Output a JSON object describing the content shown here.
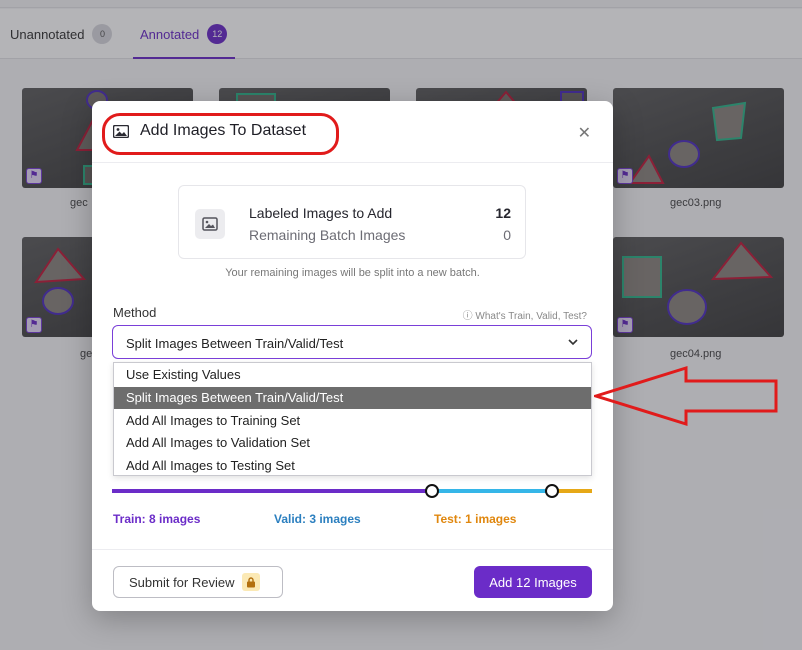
{
  "tabs": [
    {
      "label": "Unannotated",
      "count": "0"
    },
    {
      "label": "Annotated",
      "count": "12"
    }
  ],
  "thumbnails": [
    {
      "name": "gec"
    },
    {
      "name": "gec03.png"
    },
    {
      "name": "gec"
    },
    {
      "name": "gec04.png"
    }
  ],
  "modal": {
    "title": "Add Images To Dataset",
    "close_icon": "close-icon",
    "summary": {
      "labeled_label": "Labeled Images to Add",
      "labeled_value": "12",
      "remaining_label": "Remaining Batch Images",
      "remaining_value": "0",
      "note": "Your remaining images will be split into a new batch."
    },
    "method": {
      "label": "Method",
      "help": "What's Train, Valid, Test?",
      "selected": "Split Images Between Train/Valid/Test",
      "options": [
        "Use Existing Values",
        "Split Images Between Train/Valid/Test",
        "Add All Images to Training Set",
        "Add All Images to Validation Set",
        "Add All Images to Testing Set"
      ],
      "selected_index": 1
    },
    "split": {
      "train_label": "Train: 8 images",
      "valid_label": "Valid: 3 images",
      "test_label": "Test: 1 images",
      "train": 8,
      "valid": 3,
      "test": 1,
      "colors": {
        "train": "#6b2cc8",
        "valid": "#35b6e8",
        "test": "#e6a817"
      }
    },
    "footer": {
      "review_label": "Submit for Review",
      "add_label": "Add 12 Images"
    }
  },
  "colors": {
    "accent": "#6b2cc8",
    "annotation_highlight": "#e11b1b"
  }
}
